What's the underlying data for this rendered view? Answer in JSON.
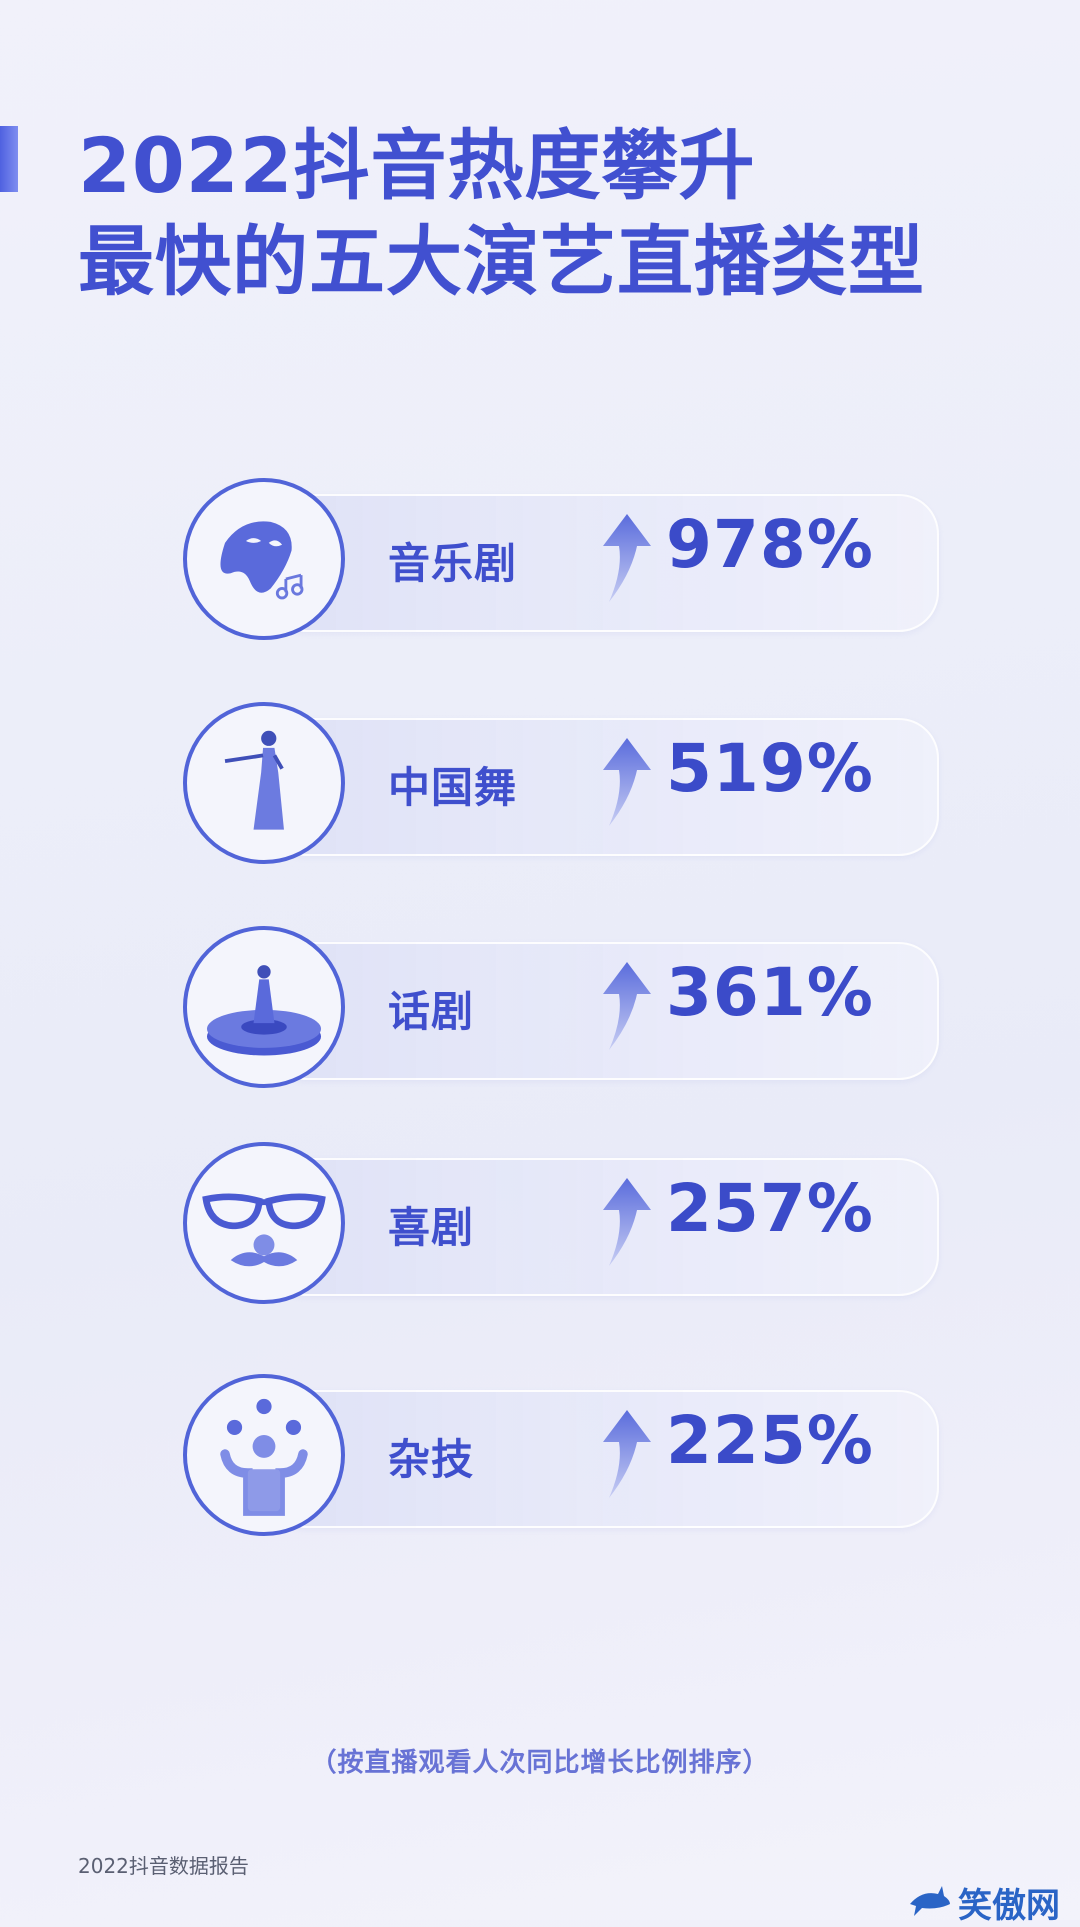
{
  "title": {
    "line1": "2022抖音热度攀升",
    "line2": "最快的五大演艺直播类型"
  },
  "items": [
    {
      "label": "音乐剧",
      "value": "978%",
      "icon": "mask-music-icon"
    },
    {
      "label": "中国舞",
      "value": "519%",
      "icon": "dancer-icon"
    },
    {
      "label": "话剧",
      "value": "361%",
      "icon": "stage-icon"
    },
    {
      "label": "喜剧",
      "value": "257%",
      "icon": "glasses-mustache-icon"
    },
    {
      "label": "杂技",
      "value": "225%",
      "icon": "juggler-icon"
    }
  ],
  "note": "（按直播观看人次同比增长比例排序）",
  "footer": "2022抖音数据报告",
  "watermark": "笑傲网",
  "colors": {
    "accent": "#4150d0",
    "ring": "#5164d8"
  }
}
